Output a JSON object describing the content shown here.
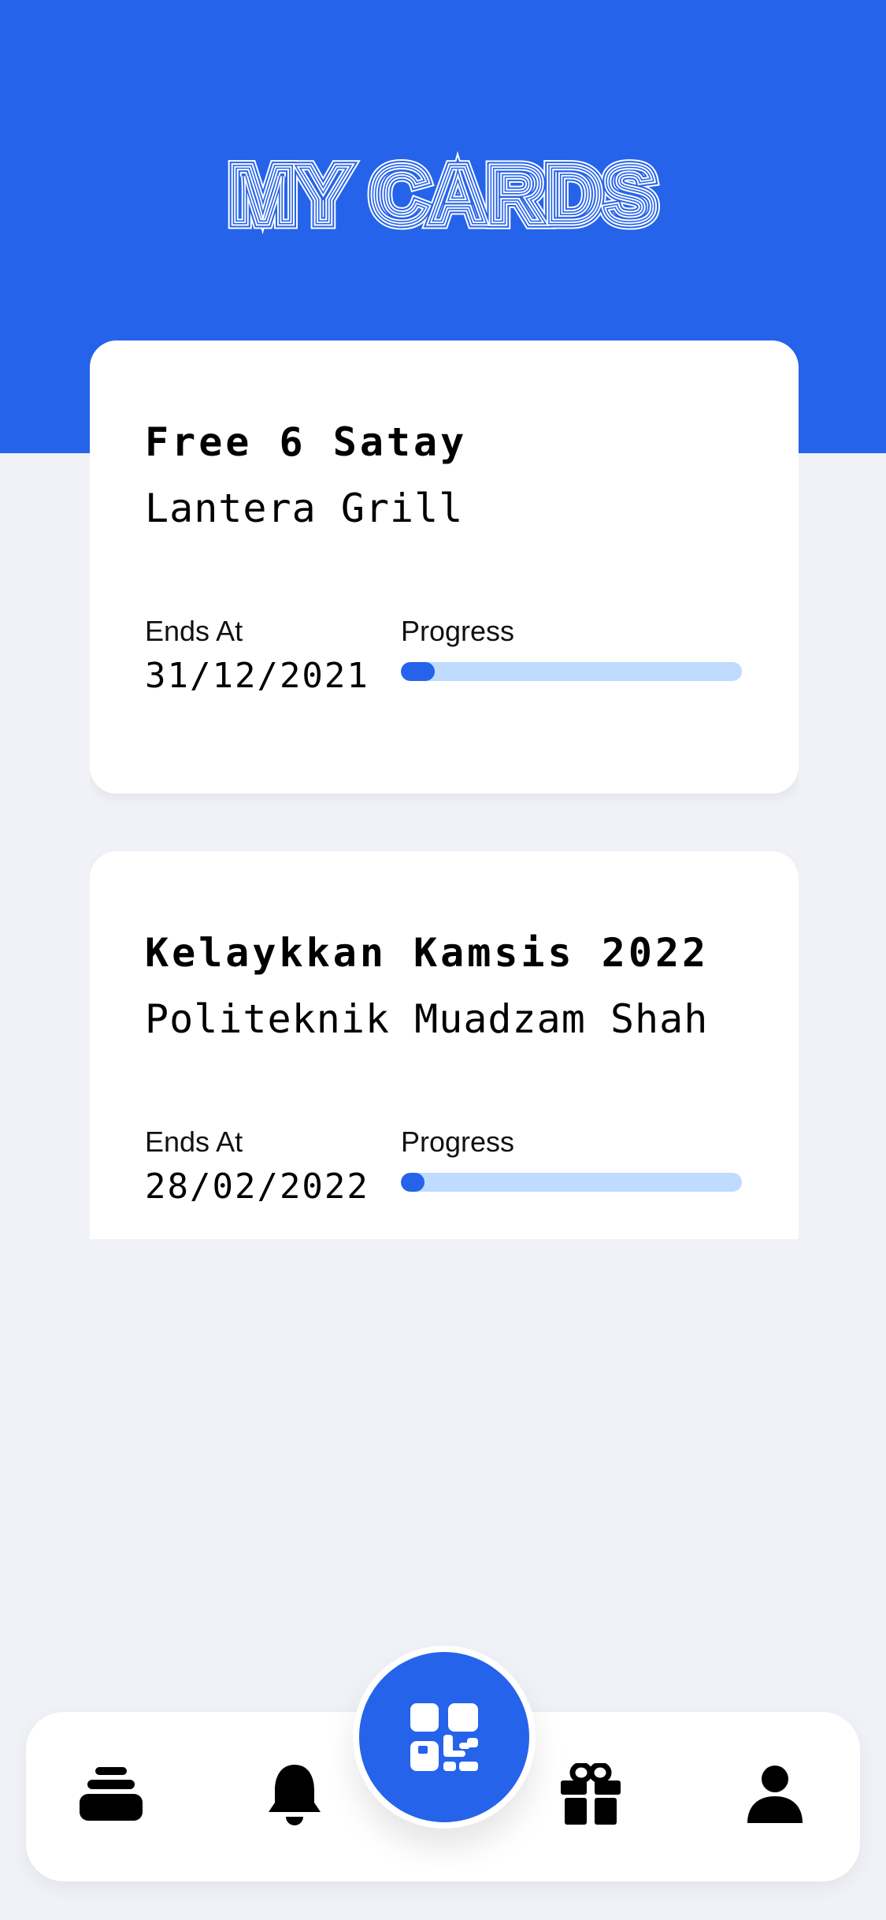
{
  "header": {
    "title": "MY CARDS",
    "band_color": "#2563EB"
  },
  "cards": [
    {
      "title": "Free 6 Satay",
      "merchant": "Lantera Grill",
      "ends_label": "Ends At",
      "ends_value": "31/12/2021",
      "progress_label": "Progress",
      "progress": 0.1
    },
    {
      "title": "Kelaykkan Kamsis 2022",
      "merchant": "Politeknik Muadzam Shah",
      "ends_label": "Ends At",
      "ends_value": "28/02/2022",
      "progress_label": "Progress",
      "progress": 0.07
    }
  ],
  "bottom_nav": {
    "items": [
      {
        "icon": "cards-stack-icon"
      },
      {
        "icon": "bell-icon"
      },
      {
        "icon": "qr-code-icon",
        "primary": true
      },
      {
        "icon": "gift-icon"
      },
      {
        "icon": "user-icon"
      }
    ]
  },
  "colors": {
    "accent": "#2563EB",
    "progress_track": "#BFDBFE",
    "background": "#F0F2F7",
    "card": "#FFFFFF"
  }
}
